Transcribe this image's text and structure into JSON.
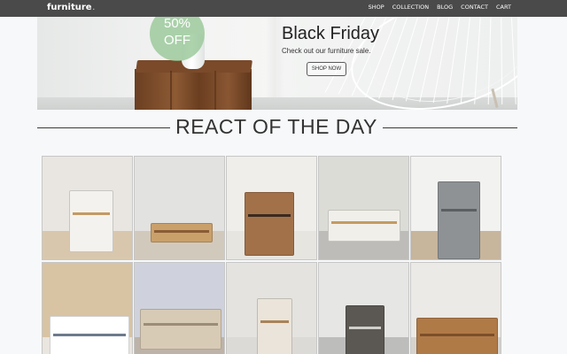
{
  "header": {
    "brand": "furniture",
    "brand_dot": ".",
    "nav": [
      "SHOP",
      "COLLECTION",
      "BLOG",
      "CONTACT",
      "CART"
    ]
  },
  "hero": {
    "badge_percent": "50%",
    "badge_off": "OFF",
    "title": "Black Friday",
    "subtitle": "Check out our furniture sale.",
    "button": "SHOP NOW"
  },
  "section": {
    "title": "REACT OF THE DAY"
  },
  "products": [
    {
      "name": "rolling-kitchen-cart",
      "wall": "#e9e6e1",
      "floor": "#d9c7ad",
      "piece": "#f4f2ee",
      "accent": "#c39a63"
    },
    {
      "name": "console-table-arched-mirror",
      "wall": "#e2e2e0",
      "floor": "#d2c9bd",
      "piece": "#caa06a",
      "accent": "#8a5c36"
    },
    {
      "name": "wine-bar-cabinet",
      "wall": "#efeeea",
      "floor": "#e7e5e0",
      "piece": "#a2714a",
      "accent": "#3b2a1f"
    },
    {
      "name": "lift-top-coffee-table",
      "wall": "#dcdcd7",
      "floor": "#bdbcb8",
      "piece": "#f1efe9",
      "accent": "#c49a63"
    },
    {
      "name": "gray-storage-cabinet",
      "wall": "#f2f2f0",
      "floor": "#c7b59c",
      "piece": "#8e9295",
      "accent": "#5b5f62"
    },
    {
      "name": "desk-with-chair",
      "wall": "#d8c3a3",
      "floor": "#e9e5df",
      "piece": "#ffffff",
      "accent": "#6c7b8c"
    },
    {
      "name": "sideboard-buffet",
      "wall": "#cfd2dc",
      "floor": "#bdb3a8",
      "piece": "#d8cbb6",
      "accent": "#9b8c78"
    },
    {
      "name": "accent-armchair",
      "wall": "#e4e3e0",
      "floor": "#dcdad6",
      "piece": "#eae4da",
      "accent": "#a9835a"
    },
    {
      "name": "nightstand-side-table",
      "wall": "#e6e6e4",
      "floor": "#bdbdbb",
      "piece": "#5b5853",
      "accent": "#d1cfc9"
    },
    {
      "name": "wood-sideboard-cabinet",
      "wall": "#eceae6",
      "floor": "#d6d2cc",
      "piece": "#b07a47",
      "accent": "#7c4f2a"
    }
  ]
}
